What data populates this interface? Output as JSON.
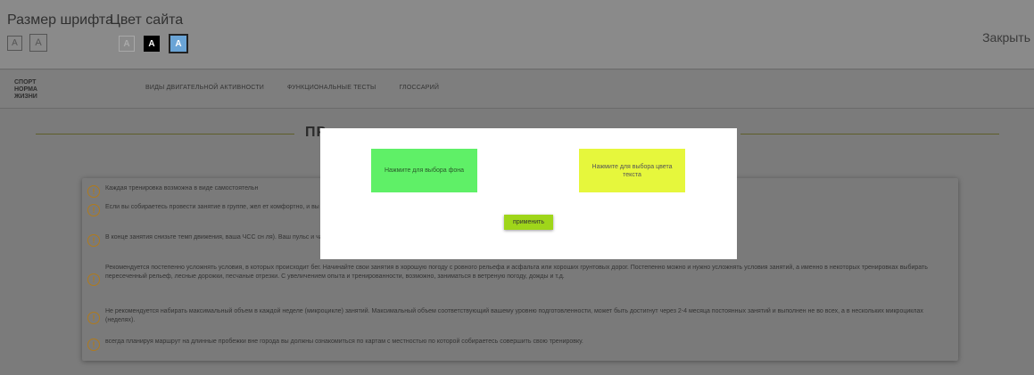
{
  "a11y": {
    "font_size_label": "Размер шрифта",
    "site_color_label": "Цвет сайта",
    "font_small": "A",
    "font_large": "A",
    "color_white": "A",
    "color_black": "A",
    "color_blue": "A",
    "close_label": "Закрыть"
  },
  "site": {
    "logo_lines": [
      "СПОРТ",
      "НОРМА",
      "ЖИЗНИ"
    ],
    "nav": [
      "ВИДЫ ДВИГАТЕЛЬНОЙ АКТИВНОСТИ",
      "ФУНКЦИОНАЛЬНЫЕ ТЕСТЫ",
      "ГЛОССАРИЙ"
    ]
  },
  "page": {
    "title": "ПР",
    "tips": [
      "Каждая тренировка возможна в виде самостоятельн",
      "Если вы собираетесь провести занятие в группе, жел                                                                                                                          ет комфортно, и вы получите удовольствие и пользу от занятия.",
      "В конце занятия снизьте темп движения, ваша ЧСС сн                                                                                                                          ля). Ваш пульс и частота дыхания придут в норму. Сделайте несколько (6-8 упражнений) на растяжку",
      "Рекомендуется постепенно усложнять условия, в которых происходит бег. Начинайте свои занятия в хорошую погоду с ровного рельефа и асфальта или хороших грунтовых дорог. Постепенно можно и нужно усложнять условия занятий, а именно в некоторых тренировках выбирать пересеченный рельеф, лесные дорожки, песчаные отрезки. С увеличением опыта и тренированности, возможно, заниматься в ветреную погоду, дожды и т.д.",
      "Не рекомендуется набирать максимальный объем в каждой неделе (микроцикле) занятий. Максимальный объем соответствующий вашему уровню подготовленности, может быть достигнут через 2-4 месяца постоянных занятий и выполнен не во всех, а в нескольких микроциклах (неделях).",
      "всегда планируя маршрут на длинные пробежки вне города вы должны ознакомиться по картам с местностью по которой собираетесь совершить свою тренировку."
    ]
  },
  "modal": {
    "bg_button": "Нажмите для выбора фона",
    "text_color_button": "Нажмите для выбора цвета текста",
    "apply_button": "применить"
  },
  "colors": {
    "bg_button": "#5ff067",
    "text_color_button": "#e6f73c",
    "apply_button": "#9fd61a",
    "tip_icon": "#b07a1c"
  }
}
